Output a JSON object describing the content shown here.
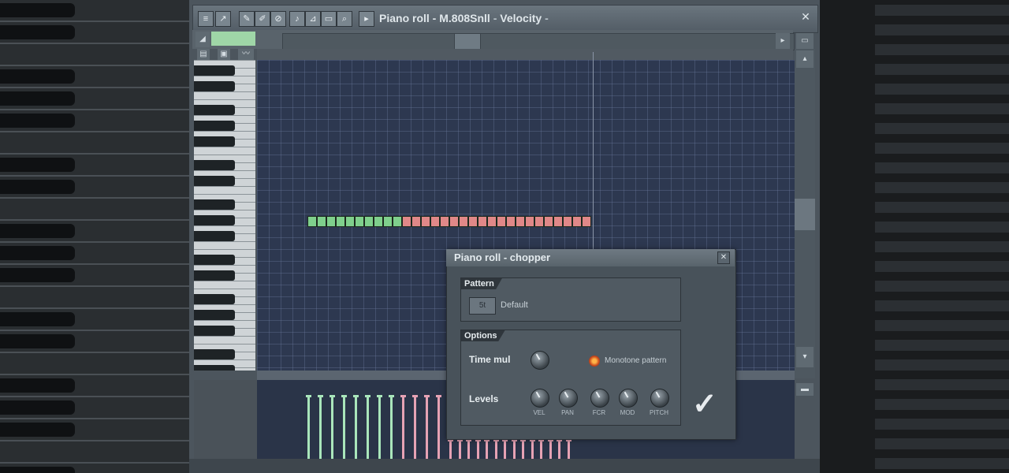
{
  "window": {
    "title": "Piano roll - M.808Snll",
    "target": "Velocity",
    "title_arrow": "-"
  },
  "toolbar": {
    "buttons": [
      "menu",
      "arrow",
      "pencil",
      "brush",
      "delete",
      "mute",
      "slice",
      "select",
      "zoom",
      "playback"
    ]
  },
  "dialog": {
    "title": "Piano roll - chopper",
    "pattern_group": "Pattern",
    "pattern_button": "5t",
    "pattern_value": "Default",
    "options_group": "Options",
    "time_mul_label": "Time mul",
    "monotone_label": "Monotone pattern",
    "levels_label": "Levels",
    "knob_labels": [
      "VEL",
      "PAN",
      "FCR",
      "MOD",
      "PITCH"
    ],
    "accept_symbol": "✓",
    "close_symbol": "✕"
  },
  "colors": {
    "note_green": "#7fd08c",
    "note_red": "#e08888",
    "grid": "#2d3850",
    "velocity_green": "#a9e6bb",
    "velocity_red": "#e6a2b4"
  },
  "notes": {
    "green_count": 10,
    "red_count": 20
  },
  "velocity": {
    "green_bars": 8,
    "red_bars": 4,
    "short_red_bars": 14
  }
}
